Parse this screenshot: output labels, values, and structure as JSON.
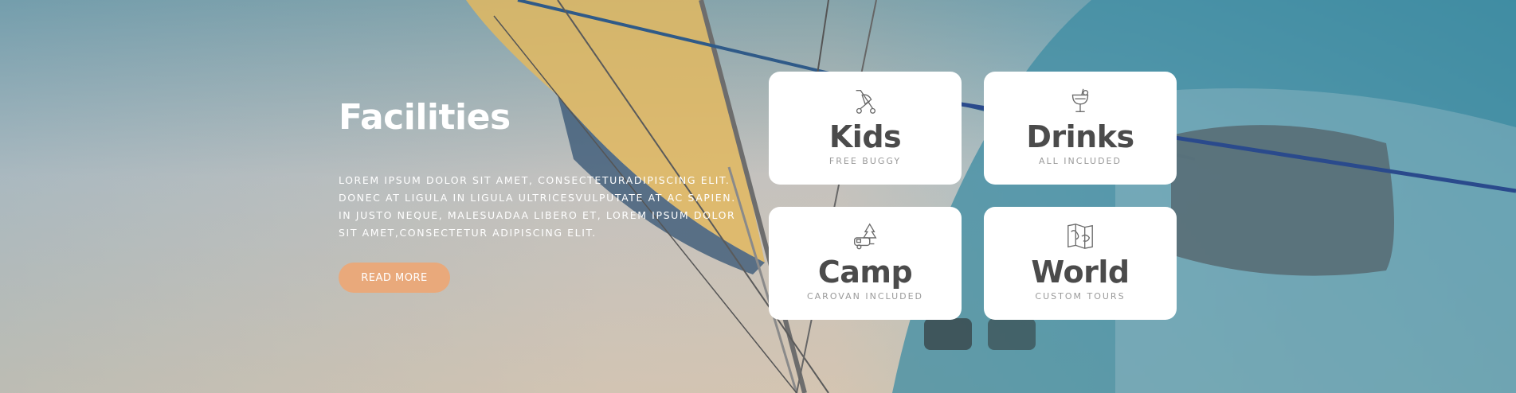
{
  "section": {
    "title": "Facilities",
    "description": "Lorem ipsum dolor sit amet, consecteturadipiscing elit. Donec at ligula in ligula ultricesvulputate at ac sapien. In justo neque, malesuadaa libero et, lorem ipsum dolor sit amet,consectetur adipiscing elit.",
    "button_label": "READ MORE"
  },
  "cards": [
    {
      "label": "Kids",
      "sub": "FREE BUGGY",
      "icon": "stroller-icon"
    },
    {
      "label": "Drinks",
      "sub": "ALL INCLUDED",
      "icon": "cocktail-icon"
    },
    {
      "label": "Camp",
      "sub": "CAROVAN INCLUDED",
      "icon": "caravan-trees-icon"
    },
    {
      "label": "World",
      "sub": "CUSTOM TOURS",
      "icon": "world-map-icon"
    }
  ],
  "colors": {
    "button": "#e9a97b",
    "card_text": "#4b4b4b",
    "card_sub": "#9a9a9a"
  }
}
